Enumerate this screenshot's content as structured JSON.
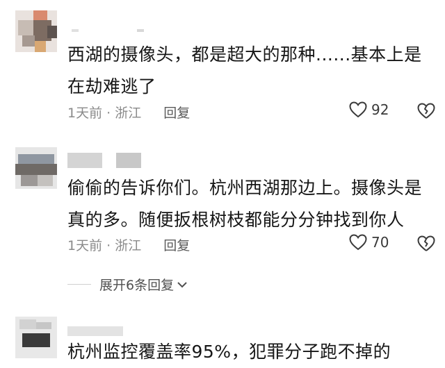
{
  "comments": [
    {
      "text": "西湖的摄像头，都是超大的那种......基本上是在劫难逃了",
      "time_loc": "1天前 · 浙江",
      "reply_label": "回复",
      "likes": "92"
    },
    {
      "text": "偷偷的告诉你们。杭州西湖那边上。摄像头是真的多。随便扳根树枝都能分分钟找到你人",
      "time_loc": "1天前 · 浙江",
      "reply_label": "回复",
      "likes": "70"
    },
    {
      "text": "杭州监控覆盖率95%，犯罪分子跑不掉的"
    }
  ],
  "expand_replies": "展开6条回复",
  "icons": {
    "like": "heart-outline-icon",
    "dislike": "broken-heart-icon",
    "expand": "chevron-down-icon"
  }
}
